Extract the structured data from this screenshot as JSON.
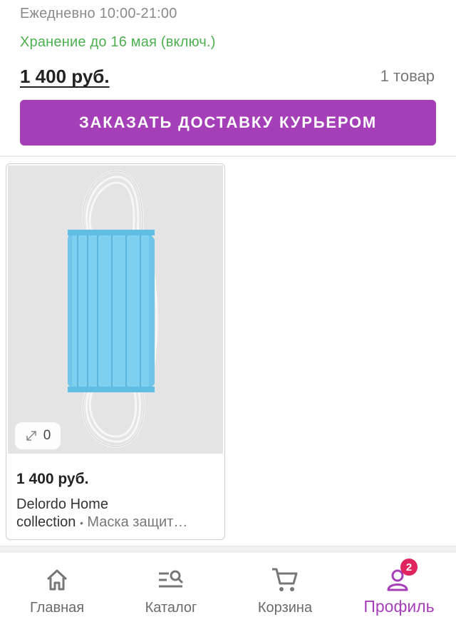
{
  "pickup": {
    "hours": "Ежедневно 10:00-21:00",
    "storage": "Хранение до 16 мая (включ.)",
    "total_price": "1 400 руб.",
    "item_count": "1 товар",
    "order_button": "ЗАКАЗАТЬ ДОСТАВКУ КУРЬЕРОМ"
  },
  "product": {
    "price": "1 400 руб.",
    "brand": "Delordo Home collection",
    "brand_line1": "Delordo Home",
    "brand_line2": "collection",
    "separator": "•",
    "name": "Маска защит…",
    "zoom_count": "0",
    "image_icon": "blue-face-mask"
  },
  "nav": {
    "items": [
      {
        "label": "Главная",
        "icon": "home-icon"
      },
      {
        "label": "Каталог",
        "icon": "catalog-search-icon"
      },
      {
        "label": "Корзина",
        "icon": "cart-icon"
      },
      {
        "label": "Профиль",
        "icon": "profile-icon",
        "badge": "2",
        "active": true
      }
    ]
  },
  "colors": {
    "accent": "#a53fb8",
    "storage_green": "#4caf50",
    "badge_red": "#e0245e"
  }
}
